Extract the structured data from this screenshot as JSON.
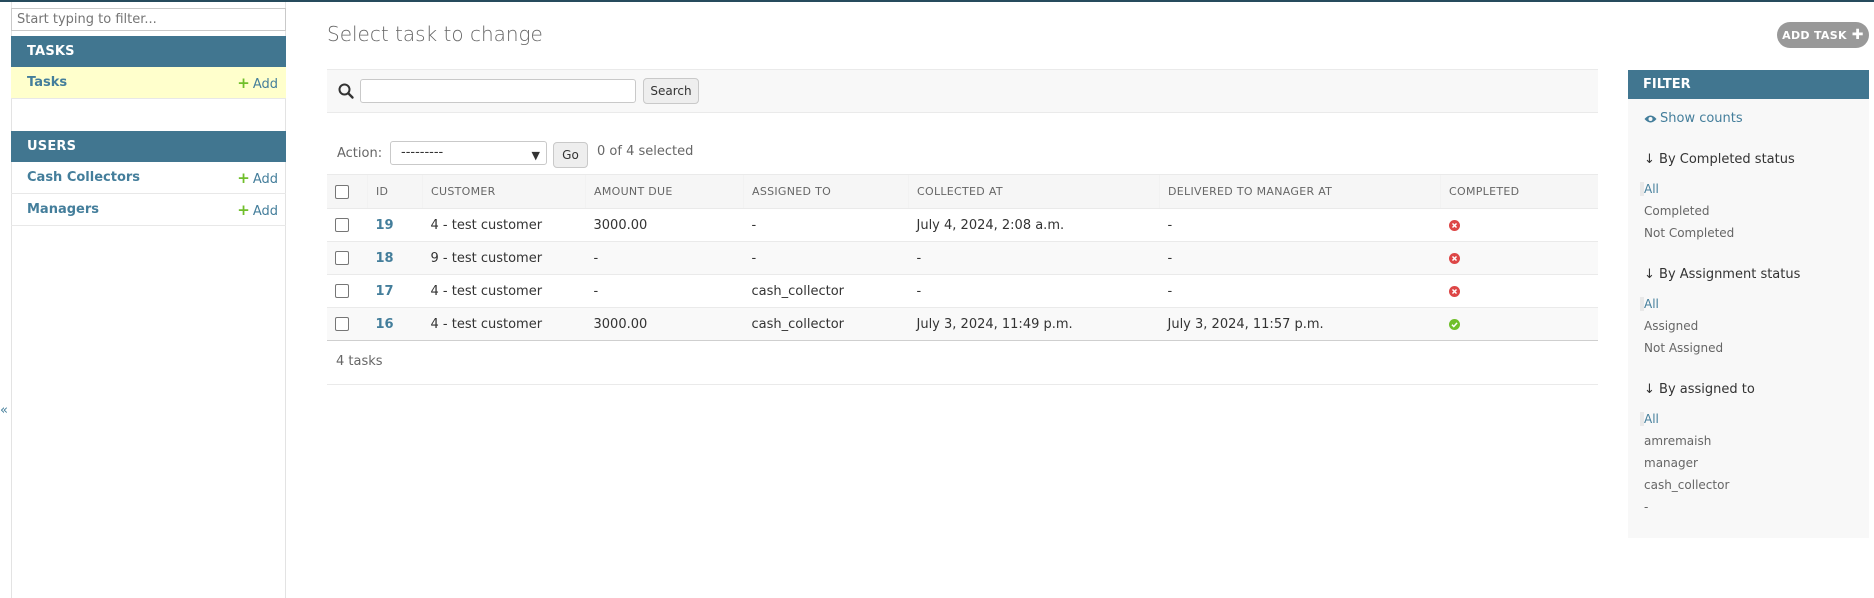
{
  "sidebar": {
    "filter_placeholder": "Start typing to filter...",
    "modules": [
      {
        "caption": "TASKS",
        "items": [
          {
            "label": "Tasks",
            "add": "Add"
          }
        ]
      },
      {
        "caption": "USERS",
        "items": [
          {
            "label": "Cash Collectors",
            "add": "Add"
          },
          {
            "label": "Managers",
            "add": "Add"
          }
        ]
      }
    ],
    "collapse_glyph": "«"
  },
  "header": {
    "title": "Select task to change",
    "add_button": "ADD TASK"
  },
  "search": {
    "button": "Search"
  },
  "actions": {
    "label": "Action:",
    "selected_option": "---------",
    "go": "Go",
    "selected_count": "0 of 4 selected"
  },
  "table": {
    "columns": [
      "ID",
      "CUSTOMER",
      "AMOUNT DUE",
      "ASSIGNED TO",
      "COLLECTED AT",
      "DELIVERED TO MANAGER AT",
      "COMPLETED"
    ],
    "rows": [
      {
        "id": "19",
        "customer": "4 - test customer",
        "amount_due": "3000.00",
        "assigned_to": "-",
        "collected_at": "July 4, 2024, 2:08 a.m.",
        "delivered_at": "-",
        "completed": false
      },
      {
        "id": "18",
        "customer": "9 - test customer",
        "amount_due": "-",
        "assigned_to": "-",
        "collected_at": "-",
        "delivered_at": "-",
        "completed": false
      },
      {
        "id": "17",
        "customer": "4 - test customer",
        "amount_due": "-",
        "assigned_to": "cash_collector",
        "collected_at": "-",
        "delivered_at": "-",
        "completed": false
      },
      {
        "id": "16",
        "customer": "4 - test customer",
        "amount_due": "3000.00",
        "assigned_to": "cash_collector",
        "collected_at": "July 3, 2024, 11:49 p.m.",
        "delivered_at": "July 3, 2024, 11:57 p.m.",
        "completed": true
      }
    ]
  },
  "paginator": {
    "text": "4 tasks"
  },
  "filter": {
    "title": "FILTER",
    "show_counts": "Show counts",
    "groups": [
      {
        "title": "↓ By Completed status",
        "options": [
          "All",
          "Completed",
          "Not Completed"
        ]
      },
      {
        "title": "↓ By Assignment status",
        "options": [
          "All",
          "Assigned",
          "Not Assigned"
        ]
      },
      {
        "title": "↓ By assigned to",
        "options": [
          "All",
          "amremaish",
          "manager",
          "cash_collector",
          "-"
        ]
      }
    ]
  },
  "colors": {
    "header": "#417690",
    "link": "#447e9b",
    "add_green": "#70bf2b",
    "error_red": "#dd4646",
    "success_green": "#70bf2b"
  }
}
